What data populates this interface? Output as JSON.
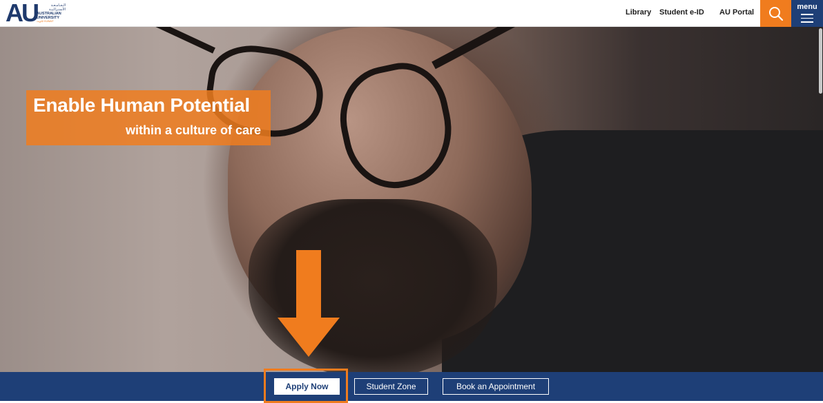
{
  "logo": {
    "mark": "AU",
    "arabic_lines": [
      "الـجـامـعـة",
      "الأستـرالـيـة"
    ],
    "english_lines": [
      "AUSTRALIAN",
      "UNIVERSITY"
    ],
    "small_line": "الكويت KUWAIT"
  },
  "nav": {
    "links": [
      "Library",
      "Student e-ID",
      "AU Portal"
    ],
    "search_icon": "search-icon",
    "menu_label": "menu",
    "menu_icon": "hamburger-icon"
  },
  "hero": {
    "headline": "Enable Human Potential",
    "subheadline": "within a culture of care"
  },
  "cta": {
    "apply": "Apply Now",
    "student_zone": "Student Zone",
    "appointment": "Book an Appointment"
  },
  "colors": {
    "brand_blue": "#1e3f77",
    "accent_orange": "#f07c1e"
  }
}
